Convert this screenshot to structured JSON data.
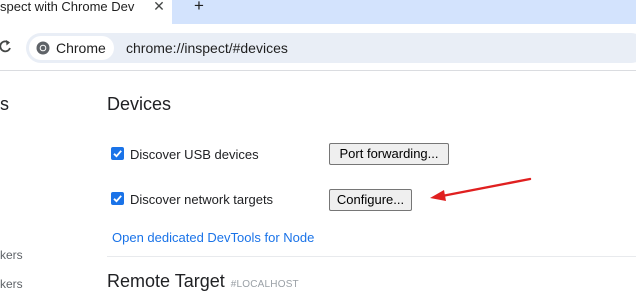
{
  "browser": {
    "tab_title": "spect with Chrome Dev",
    "tab_close": "✕",
    "new_tab": "+",
    "omnibox_chip": "Chrome",
    "url": "chrome://inspect/#devices"
  },
  "sidebar": {
    "cut_heading": "s",
    "item_1": "kers",
    "item_2": "kers"
  },
  "devices": {
    "title": "Devices",
    "discover_usb": {
      "label": "Discover USB devices",
      "checked": true
    },
    "port_forwarding_button": "Port forwarding...",
    "discover_network": {
      "label": "Discover network targets",
      "checked": true
    },
    "configure_button": "Configure...",
    "node_link": "Open dedicated DevTools for Node"
  },
  "remote_target": {
    "title": "Remote Target",
    "host": "#LOCALHOST"
  },
  "colors": {
    "accent": "#1a73e8",
    "annotation_arrow": "#e02020",
    "tabstrip": "#d3e3fd",
    "omnibox": "#e9eef6"
  }
}
